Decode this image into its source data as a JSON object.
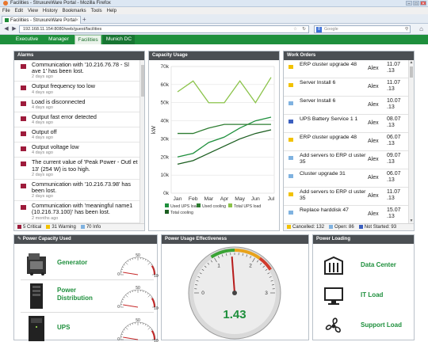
{
  "browser": {
    "window_title": "Facilities - StruxureWare Portal - Mozilla Firefox",
    "menu": [
      "File",
      "Edit",
      "View",
      "History",
      "Bookmarks",
      "Tools",
      "Help"
    ],
    "tab_title": "Facilities - StruxureWare Portal",
    "url": "192.168.11.154:8080/web/guest/facilities",
    "search_placeholder": "Google"
  },
  "nav_tabs": [
    {
      "label": "Executive",
      "state": "normal"
    },
    {
      "label": "Manager",
      "state": "normal"
    },
    {
      "label": "Facilities",
      "state": "active"
    },
    {
      "label": "Munich DC",
      "state": "hover"
    }
  ],
  "alarms": {
    "title": "Alarms",
    "items": [
      {
        "msg": "Communication with '10.216.76.78 - Sl ave 1' has been lost.",
        "ago": "2 days ago"
      },
      {
        "msg": "Output frequency too low",
        "ago": "4 days ago"
      },
      {
        "msg": "Load is disconnected",
        "ago": "4 days ago"
      },
      {
        "msg": "Output fast error detected",
        "ago": "4 days ago"
      },
      {
        "msg": "Output off",
        "ago": "4 days ago"
      },
      {
        "msg": "Output voltage low",
        "ago": "4 days ago"
      },
      {
        "msg": "The current value of 'Peak Power - Outl et 13' (254 W) is too high.",
        "ago": "2 days ago"
      },
      {
        "msg": "Communication with '10.216.73.98' has been lost.",
        "ago": "2 days ago"
      },
      {
        "msg": "Communication with 'meaningful name1 (10.216.73.100)' has been lost.",
        "ago": "2 months ago"
      },
      {
        "msg": "Communication with 'meaningful name1",
        "ago": ""
      }
    ],
    "footer": [
      {
        "label": "5 Critical",
        "color": "#9e1b3b"
      },
      {
        "label": "31 Warning",
        "color": "#f2c200"
      },
      {
        "label": "70 Info",
        "color": "#7fb2e0"
      }
    ]
  },
  "capacity_usage": {
    "title": "Capacity Usage",
    "chart_data": {
      "type": "line",
      "categories": [
        "Jan",
        "Feb",
        "Mar",
        "Apr",
        "May",
        "Jun",
        "Jul"
      ],
      "ylabel": "kW",
      "ylim": [
        0,
        70000
      ],
      "yticks": [
        "0k",
        "10k",
        "20k",
        "30k",
        "40k",
        "50k",
        "60k",
        "70k"
      ],
      "series": [
        {
          "name": "Used UPS load",
          "color": "#1e8f3c",
          "values": [
            20000,
            22000,
            28000,
            31000,
            36000,
            40000,
            42000
          ]
        },
        {
          "name": "Used cooling",
          "color": "#2e7d32",
          "values": [
            33000,
            33000,
            36000,
            38000,
            38000,
            38000,
            38000
          ]
        },
        {
          "name": "Total UPS load",
          "color": "#8bc34a",
          "values": [
            56000,
            62000,
            50000,
            50000,
            62000,
            50000,
            64000
          ]
        },
        {
          "name": "Total cooling",
          "color": "#1b5e20",
          "values": [
            16000,
            18000,
            22000,
            26000,
            30000,
            33000,
            35000
          ]
        }
      ],
      "legend": "bottom"
    }
  },
  "work_orders": {
    "title": "Work Orders",
    "items": [
      {
        "title": "ERP cluster upgrade 48",
        "who": "Alex",
        "date": "11.07 .13",
        "color": "#f2c200"
      },
      {
        "title": "Server Install 6",
        "who": "Alex",
        "date": "11.07 .13",
        "color": "#f2c200"
      },
      {
        "title": "Server Install 6",
        "who": "Alex",
        "date": "10.07 .13",
        "color": "#7fb2e0"
      },
      {
        "title": "UPS Battery Service 1 1",
        "who": "Alex",
        "date": "08.07 .13",
        "color": "#3b5fbf"
      },
      {
        "title": "ERP cluster upgrade 48",
        "who": "Alex",
        "date": "06.07 .13",
        "color": "#f2c200"
      },
      {
        "title": "Add servers to ERP cl uster 35",
        "who": "Alex",
        "date": "09.07 .13",
        "color": "#7fb2e0"
      },
      {
        "title": "Cluster upgrade 31",
        "who": "Alex",
        "date": "06.07 .13",
        "color": "#7fb2e0"
      },
      {
        "title": "Add servers to ERP cl uster 35",
        "who": "Alex",
        "date": "11.07 .13",
        "color": "#f2c200"
      },
      {
        "title": "Replace harddisk 47",
        "who": "Alex",
        "date": "15.07 .13",
        "color": "#7fb2e0"
      },
      {
        "title": "ERP cluster upgrade 48",
        "who": "Alex",
        "date": "11.07 .13",
        "color": "#f2c200"
      }
    ],
    "footer": [
      {
        "label": "Cancelled: 132",
        "color": "#f2c200"
      },
      {
        "label": "Open: 86",
        "color": "#7fb2e0"
      },
      {
        "label": "Not Started: 93",
        "color": "#3b5fbf"
      }
    ]
  },
  "power_capacity": {
    "title": "Power Capacity Used",
    "items": [
      {
        "name": "Generator",
        "gauge_min": "0",
        "gauge_max": "100",
        "gauge_mid": "50",
        "level": 0.05
      },
      {
        "name": "Power Distribution",
        "gauge_min": "0",
        "gauge_max": "100",
        "gauge_mid": "50",
        "level": 0.05
      },
      {
        "name": "UPS",
        "gauge_min": "0",
        "gauge_max": "100",
        "gauge_mid": "50",
        "level": 0.05
      }
    ]
  },
  "pue": {
    "title": "Power Usage Effectiveness",
    "value": "1.43",
    "scale": [
      "0",
      "1",
      "2",
      "3"
    ],
    "needle_value": 1.43
  },
  "power_loading": {
    "title": "Power Loading",
    "items": [
      {
        "label": "Data Center",
        "icon": "datacenter-icon"
      },
      {
        "label": "IT Load",
        "icon": "monitor-icon"
      },
      {
        "label": "Support Load",
        "icon": "fan-icon"
      }
    ]
  }
}
